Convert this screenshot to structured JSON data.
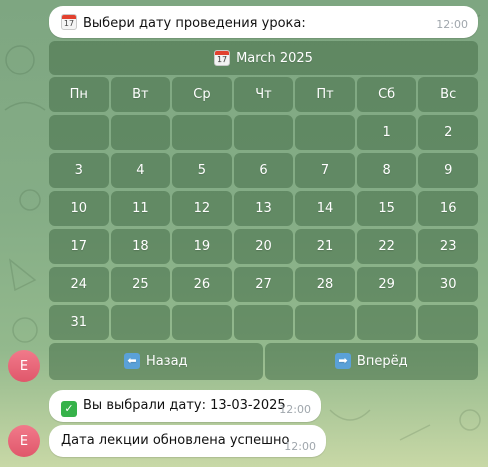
{
  "prompt_message": {
    "text": "Выбери дату проведения урока:",
    "time": "12:00",
    "icon": "calendar-icon",
    "icon_day": "17"
  },
  "calendar": {
    "header_title": "March 2025",
    "header_icon": "calendar-icon",
    "weekdays": [
      "Пн",
      "Вт",
      "Ср",
      "Чт",
      "Пт",
      "Сб",
      "Вс"
    ],
    "weeks": [
      [
        "",
        "",
        "",
        "",
        "",
        "1",
        "2"
      ],
      [
        "3",
        "4",
        "5",
        "6",
        "7",
        "8",
        "9"
      ],
      [
        "10",
        "11",
        "12",
        "13",
        "14",
        "15",
        "16"
      ],
      [
        "17",
        "18",
        "19",
        "20",
        "21",
        "22",
        "23"
      ],
      [
        "24",
        "25",
        "26",
        "27",
        "28",
        "29",
        "30"
      ],
      [
        "31",
        "",
        "",
        "",
        "",
        "",
        ""
      ]
    ],
    "back_label": "Назад",
    "back_icon": "left-arrow-icon",
    "forward_label": "Вперёд",
    "forward_icon": "right-arrow-icon"
  },
  "selection_message": {
    "text": "Вы выбрали дату: 13-03-2025",
    "time": "12:00",
    "icon": "check-mark-icon"
  },
  "update_message": {
    "text": "Дата лекции обновлена успешно",
    "time": "12:00"
  },
  "avatar": {
    "letter": "E",
    "color": "#e8667a"
  }
}
